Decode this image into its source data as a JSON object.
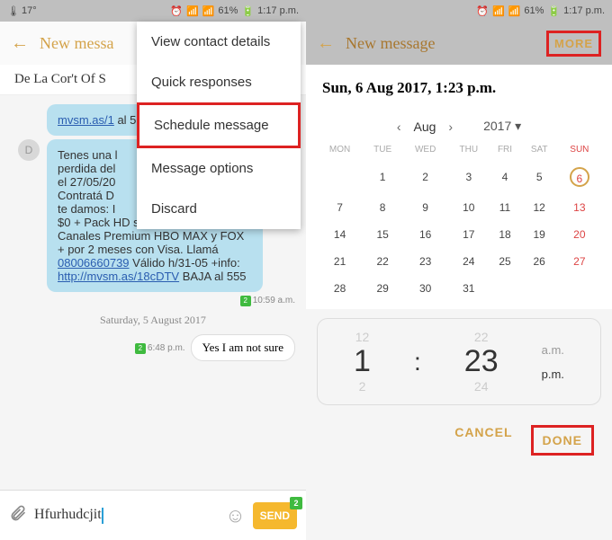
{
  "statusbar": {
    "temp": "17°",
    "battery": "61%",
    "time": "1:17 p.m."
  },
  "left": {
    "header_title": "New messa",
    "recipient": "De La Cor't Of S",
    "bubble_top_link": "mvsm.as/1",
    "bubble_top_tail": " al 555",
    "msg1_a": "Tenes una l",
    "msg1_b": "perdida del",
    "msg1_c": "el 27/05/20",
    "msg1_d": "Contratá D",
    "msg1_e": "te damos: I",
    "msg1_f": "$0 + Pack HD sin cargo x 18meses + Canales Premium HBO MAX y FOX + por 2 meses con Visa. Llamá ",
    "msg1_phone": "08006660739",
    "msg1_g": " Válido h/31-05 +info: ",
    "msg1_link": "http://mvsm.as/18cDTV",
    "msg1_h": " BAJA al 555",
    "ts1": "10:59 a.m.",
    "date_divider": "Saturday, 5 August 2017",
    "ts2": "6:48 p.m.",
    "reply_text": "Yes I am not sure",
    "compose_value": "Hfurhudcjit",
    "send_label": "SEND",
    "send_badge": "2",
    "menu": {
      "i0": "View contact details",
      "i1": "Quick responses",
      "i2": "Schedule message",
      "i3": "Message options",
      "i4": "Discard"
    }
  },
  "right": {
    "header_title": "New message",
    "more": "MORE",
    "selected_date": "Sun, 6 Aug 2017, 1:23 p.m.",
    "month": "Aug",
    "year": "2017",
    "dow": {
      "mon": "MON",
      "tue": "TUE",
      "wed": "WED",
      "thu": "THU",
      "fri": "FRI",
      "sat": "SAT",
      "sun": "SUN"
    },
    "cal": {
      "r1": [
        "",
        "1",
        "2",
        "3",
        "4",
        "5",
        "6"
      ],
      "r2": [
        "7",
        "8",
        "9",
        "10",
        "11",
        "12",
        "13"
      ],
      "r3": [
        "14",
        "15",
        "16",
        "17",
        "18",
        "19",
        "20"
      ],
      "r4": [
        "21",
        "22",
        "23",
        "24",
        "25",
        "26",
        "27"
      ],
      "r5": [
        "28",
        "29",
        "30",
        "31",
        "",
        "",
        ""
      ]
    },
    "time": {
      "h_prev": "12",
      "h": "1",
      "h_next": "2",
      "m_prev": "22",
      "m": "23",
      "m_next": "24",
      "am": "a.m.",
      "pm": "p.m."
    },
    "cancel": "CANCEL",
    "done": "DONE"
  }
}
